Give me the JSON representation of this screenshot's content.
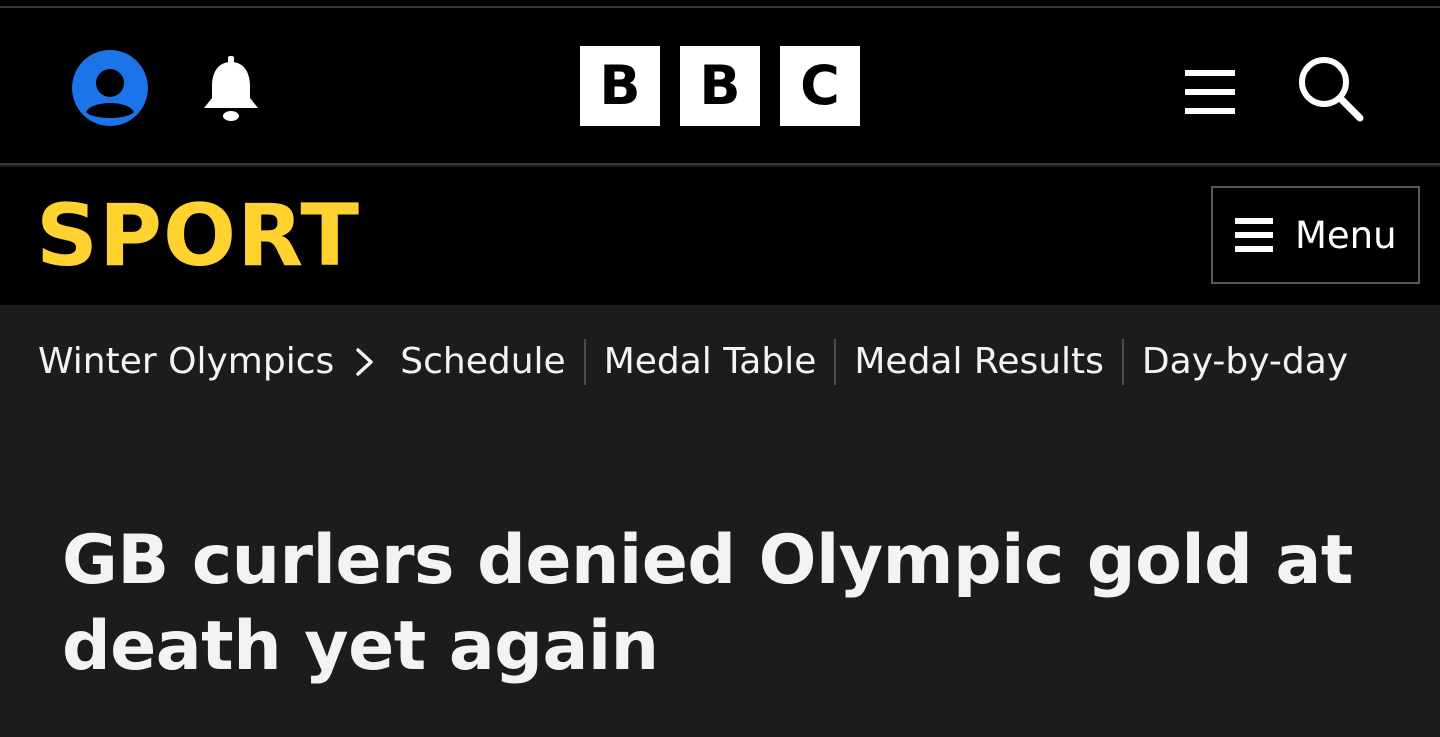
{
  "masthead": {
    "logo_letters": [
      "B",
      "B",
      "C"
    ],
    "icons": {
      "account": "account-icon",
      "notifications": "bell-icon",
      "menu": "hamburger-icon",
      "search": "search-icon"
    },
    "accent_color": "#1b74e8"
  },
  "sport_bar": {
    "title": "SPORT",
    "title_color": "#ffd230",
    "menu_label": "Menu"
  },
  "subnav": {
    "section": "Winter Olympics",
    "links": [
      "Schedule",
      "Medal Table",
      "Medal Results",
      "Day-by-day"
    ]
  },
  "article": {
    "headline": "GB curlers denied Olympic gold at death yet again"
  }
}
